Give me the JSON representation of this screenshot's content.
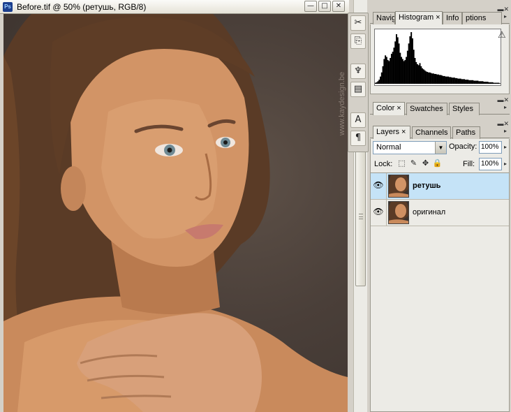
{
  "document": {
    "title": "Before.tif @ 50% (ретушь, RGB/8)",
    "app_icon_label": "Ps",
    "watermark": "www.kaydesign.be",
    "buttons": {
      "minimize": "—",
      "maximize": "□",
      "close": "✕"
    }
  },
  "tools": [
    {
      "name": "tool-brush-preset-icon",
      "glyph": "✂"
    },
    {
      "name": "tool-clone-source-icon",
      "glyph": "⎘"
    },
    {
      "name": "tool-tool-presets-icon",
      "glyph": "♆"
    },
    {
      "name": "tool-layer-comps-icon",
      "glyph": "▤"
    },
    {
      "name": "tool-character-icon",
      "glyph": "A"
    },
    {
      "name": "tool-paragraph-icon",
      "glyph": "¶"
    }
  ],
  "histogram_panel": {
    "tabs": [
      "Navig",
      "Histogram",
      "Info",
      "ptions"
    ],
    "active_tab": "Histogram",
    "close_glyph": "×",
    "menu_glyph": "▸",
    "warning_glyph": "⚠",
    "bins": [
      2,
      3,
      5,
      8,
      14,
      22,
      34,
      48,
      55,
      52,
      46,
      44,
      50,
      58,
      62,
      70,
      82,
      96,
      90,
      78,
      60,
      52,
      48,
      44,
      46,
      52,
      64,
      78,
      92,
      100,
      88,
      66,
      50,
      42,
      38,
      36,
      40,
      34,
      30,
      28,
      26,
      24,
      23,
      22,
      22,
      21,
      20,
      20,
      19,
      19,
      18,
      18,
      17,
      17,
      16,
      15,
      15,
      14,
      14,
      14,
      13,
      13,
      12,
      12,
      12,
      11,
      11,
      10,
      10,
      10,
      9,
      9,
      9,
      8,
      8,
      8,
      7,
      7,
      7,
      7,
      6,
      6,
      6,
      6,
      5,
      5,
      5,
      5,
      4,
      4,
      4,
      4,
      3,
      3,
      3,
      3,
      2,
      2,
      2,
      2,
      2,
      1
    ]
  },
  "color_panel": {
    "tabs": [
      "Color",
      "Swatches",
      "Styles"
    ],
    "active_tab": "Color",
    "close_glyph": "×",
    "menu_glyph": "▸"
  },
  "layers_panel": {
    "tabs": [
      "Layers",
      "Channels",
      "Paths"
    ],
    "active_tab": "Layers",
    "close_glyph": "×",
    "menu_glyph": "▸",
    "blend_mode": "Normal",
    "dropdown_glyph": "▼",
    "opacity_label": "Opacity:",
    "opacity_value": "100%",
    "lock_label": "Lock:",
    "fill_label": "Fill:",
    "fill_value": "100%",
    "layers": [
      {
        "name": "ретушь",
        "visible_glyph": "👁",
        "selected": true
      },
      {
        "name": "оригинал",
        "visible_glyph": "👁",
        "selected": false
      }
    ]
  },
  "colors": {
    "selected_layer": "#c5e3f7",
    "panel_bg": "#ecebe6",
    "chrome": "#d4d0c8"
  }
}
